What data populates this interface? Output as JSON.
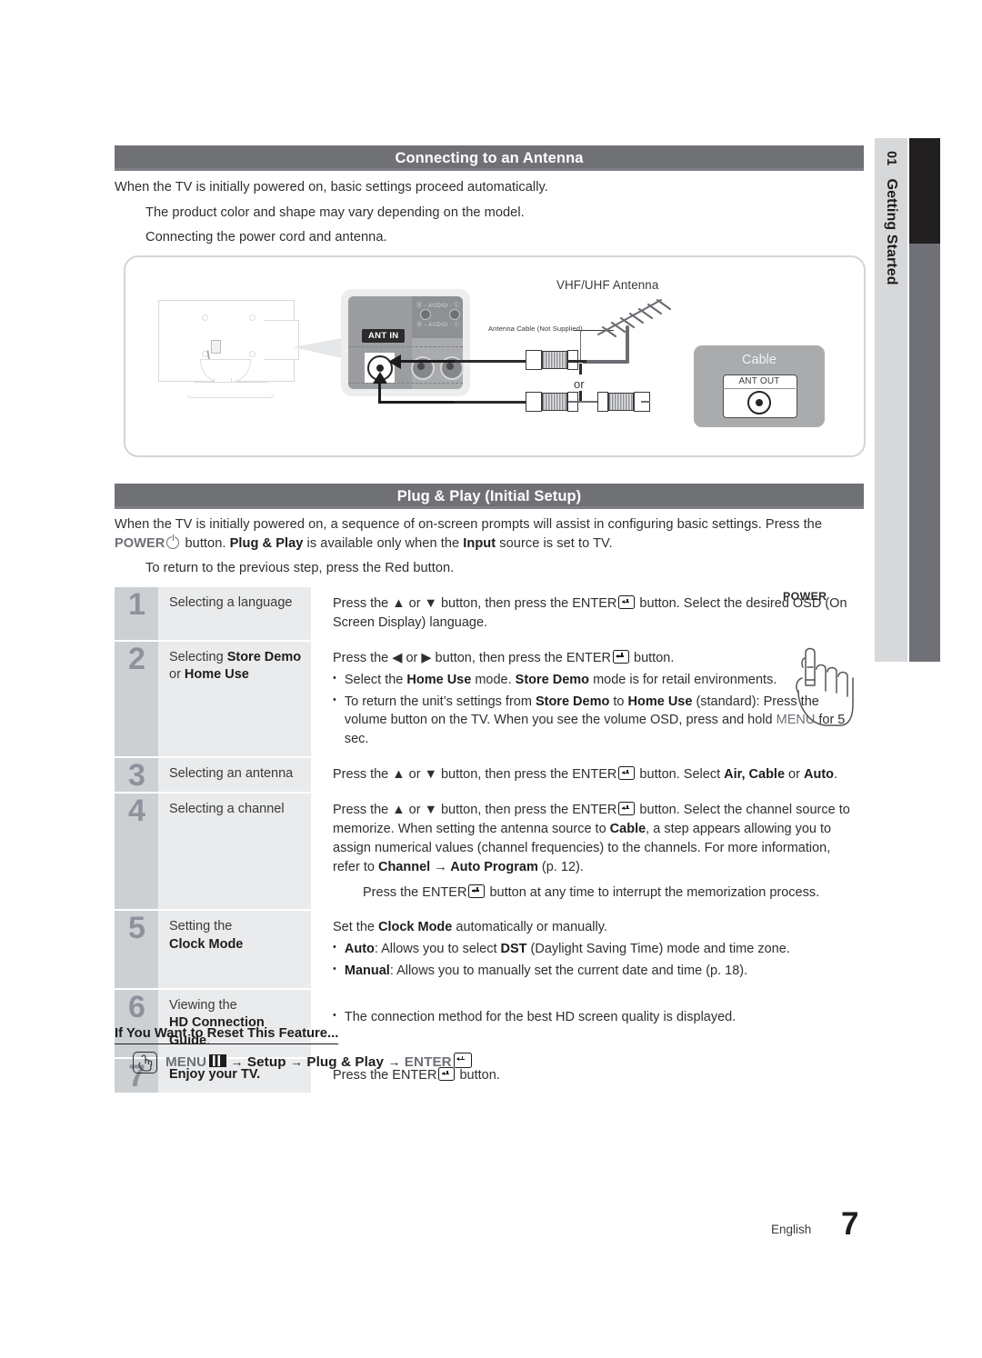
{
  "sidetab": {
    "number": "01",
    "label": "Getting Started"
  },
  "section1": {
    "title": "Connecting to an Antenna",
    "p1": "When the TV is initially powered on, basic settings proceed automatically.",
    "p2": "The product color and shape may vary depending on the model.",
    "p3": "Connecting the power cord and antenna."
  },
  "diagram": {
    "ant_in_label": "ANT IN",
    "audio_row1": "Ⓡ - AUDIO - Ⓛ",
    "audio_row2": "Ⓡ - AUDIO - Ⓛ",
    "antenna_title": "VHF/UHF Antenna",
    "antenna_cable_label": "Antenna Cable (Not Supplied)",
    "or_label": "or",
    "cable_box_title": "Cable",
    "ant_out_label": "ANT OUT"
  },
  "section2": {
    "title": "Plug & Play (Initial Setup)",
    "intro_a": "When the TV is initially powered on, a sequence of on-screen prompts will assist in configuring basic settings. Press the ",
    "intro_power": "POWER",
    "intro_b": " button. ",
    "intro_pnp": "Plug & Play",
    "intro_c": " is available only when the ",
    "intro_input": "Input",
    "intro_d": " source is set to TV.",
    "note": "To return to the previous step, press the Red button."
  },
  "steps": [
    {
      "num": "1",
      "label_plain": "Selecting a language",
      "desc_1a": "Press the ▲ or ▼ button, then press the ENTER",
      "desc_1b": " button. Select the desired OSD (On Screen Display) language."
    },
    {
      "num": "2",
      "label_a": "Selecting ",
      "label_b": "Store Demo",
      "label_c": "or ",
      "label_d": "Home Use",
      "desc_head_a": "Press the ◀ or ▶ button, then press the ENTER",
      "desc_head_b": " button.",
      "b1_a": "Select the ",
      "b1_b": "Home Use",
      "b1_c": " mode. ",
      "b1_d": "Store Demo",
      "b1_e": " mode is for retail environments.",
      "b2_a": "To return the unit’s settings from ",
      "b2_b": "Store Demo",
      "b2_c": " to ",
      "b2_d": "Home Use",
      "b2_e": " (standard): Press the volume button on the TV. When you see the volume OSD, press and hold ",
      "b2_f": "MENU",
      "b2_g": " for 5 sec."
    },
    {
      "num": "3",
      "label_plain": "Selecting an antenna",
      "desc_a": "Press the ▲ or ▼ button, then press the ENTER",
      "desc_b": " button. Select ",
      "desc_c": "Air, Cable",
      "desc_d": " or ",
      "desc_e": "Auto",
      "desc_f": "."
    },
    {
      "num": "4",
      "label_plain": "Selecting a channel",
      "desc_a": "Press the ▲ or ▼ button, then press the ENTER",
      "desc_b": " button. Select the channel source to memorize. When setting the antenna source to ",
      "desc_c": "Cable",
      "desc_d": ", a step appears allowing you to assign numerical values (channel frequencies) to the channels. For more information, refer to ",
      "desc_e": "Channel → Auto Program",
      "desc_f": " (p. 12).",
      "sub_a": "Press the ENTER",
      "sub_b": " button at any time to interrupt the memorization process."
    },
    {
      "num": "5",
      "label_a": "Setting the",
      "label_b": "Clock Mode",
      "desc_head_a": "Set the ",
      "desc_head_b": "Clock Mode",
      "desc_head_c": " automatically or manually.",
      "b1_a": "Auto",
      "b1_b": ": Allows you to select ",
      "b1_c": "DST",
      "b1_d": " (Daylight Saving Time) mode and time zone.",
      "b2_a": "Manual",
      "b2_b": ": Allows you to manually set the current date and time (p. 18)."
    },
    {
      "num": "6",
      "label_a": "Viewing the",
      "label_b": "HD Connection Guide",
      "label_c": ".",
      "b1": "The connection method for the best HD screen quality is displayed."
    },
    {
      "num": "7",
      "label_b": "Enjoy your TV.",
      "desc_a": "Press the ENTER",
      "desc_b": " button."
    }
  ],
  "power_callout": {
    "label": "POWER"
  },
  "reset": {
    "title": "If You Want to Reset This Feature...",
    "menu": "MENU",
    "arrow1": "→",
    "setup": "Setup",
    "arrow2": "→",
    "plugplay": "Plug & Play",
    "arrow3": "→",
    "enter": "ENTER"
  },
  "footer": {
    "language": "English",
    "page": "7"
  }
}
